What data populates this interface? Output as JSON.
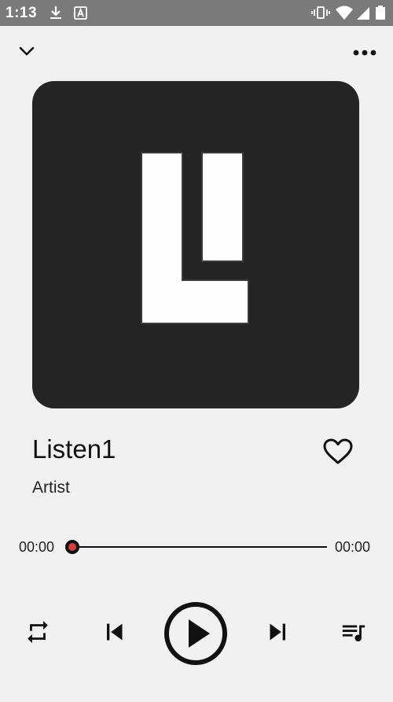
{
  "status_bar": {
    "time": "1:13",
    "icons": [
      "download-icon",
      "a-letter-icon",
      "vibrate-icon",
      "wifi-icon",
      "cell-signal-icon",
      "battery-icon"
    ]
  },
  "header": {
    "collapse_icon": "chevron-down-icon",
    "more_icon": "more-horizontal-icon"
  },
  "album_art": {
    "logo_icon": "app-logo-icon"
  },
  "track": {
    "title": "Listen1",
    "artist": "Artist",
    "favorite_icon": "heart-outline-icon"
  },
  "progress": {
    "current_time": "00:00",
    "total_time": "00:00",
    "fraction": 0
  },
  "controls": {
    "repeat_icon": "repeat-icon",
    "previous_icon": "skip-previous-icon",
    "play_icon": "play-circle-icon",
    "next_icon": "skip-next-icon",
    "playlist_icon": "queue-music-icon"
  },
  "colors": {
    "accent": "#d04040",
    "art_background": "#242424",
    "status_bar": "#7a7a7a",
    "page_background": "#f1f1f1"
  }
}
